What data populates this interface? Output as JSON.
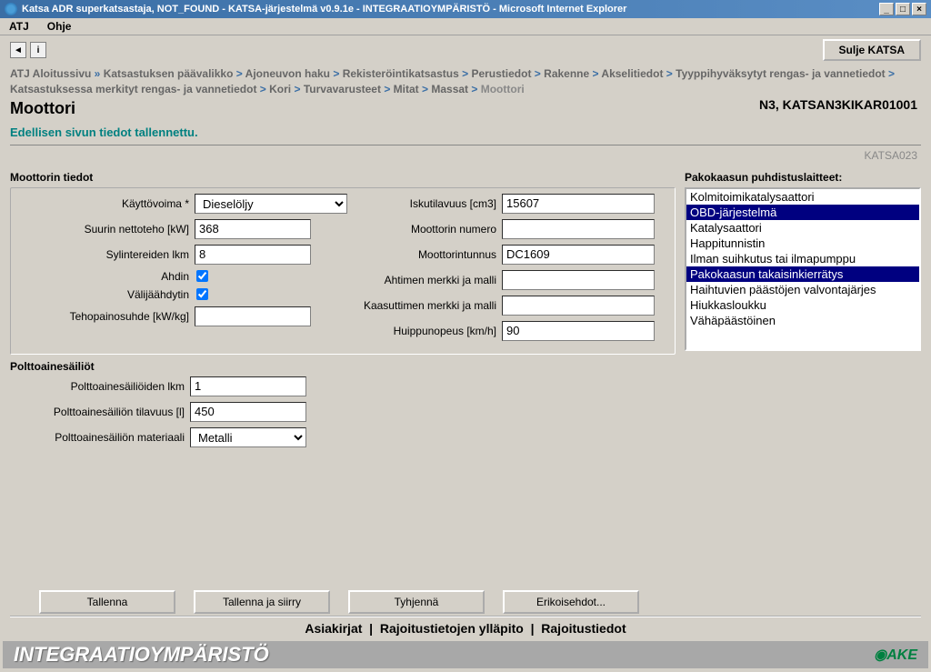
{
  "window": {
    "title": "Katsa ADR superkatsastaja, NOT_FOUND - KATSA-järjestelmä v0.9.1e - INTEGRAATIOYMPÄRISTÖ - Microsoft Internet Explorer"
  },
  "menubar": {
    "atj": "ATJ",
    "ohje": "Ohje"
  },
  "toolbar": {
    "close_katsa": "Sulje KATSA"
  },
  "breadcrumb": {
    "items": [
      "ATJ Aloitussivu",
      "Katsastuksen päävalikko",
      "Ajoneuvon haku",
      "Rekisteröintikatsastus",
      "Perustiedot",
      "Rakenne",
      "Akselitiedot",
      "Tyyppihyväksytyt rengas- ja vannetiedot",
      "Katsastuksessa merkityt rengas- ja vannetiedot",
      "Kori",
      "Turvavarusteet",
      "Mitat",
      "Massat",
      "Moottori"
    ]
  },
  "page": {
    "title": "Moottori",
    "vehicle_id": "N3, KATSAN3KIKAR01001",
    "status": "Edellisen sivun tiedot tallennettu.",
    "form_code": "KATSA023"
  },
  "sections": {
    "engine": "Moottorin tiedot",
    "fueltanks": "Polttoainesäiliöt",
    "exhaust": "Pakokaasun puhdistuslaitteet:"
  },
  "labels": {
    "fuel": "Käyttövoima *",
    "power": "Suurin nettoteho [kW]",
    "cylinders": "Sylintereiden lkm",
    "turbo": "Ahdin",
    "intercooler": "Välijäähdytin",
    "powerweight": "Tehopainosuhde [kW/kg]",
    "displacement": "Iskutilavuus [cm3]",
    "engineno": "Moottorin numero",
    "enginecode": "Moottorintunnus",
    "turbomodel": "Ahtimen merkki ja malli",
    "carbmodel": "Kaasuttimen merkki ja malli",
    "topspeed": "Huippunopeus [km/h]",
    "tankcount": "Polttoainesäiliöiden lkm",
    "tankvol": "Polttoainesäiliön tilavuus [l]",
    "tankmat": "Polttoainesäiliön materiaali"
  },
  "values": {
    "fuel": "Dieselöljy",
    "power": "368",
    "cylinders": "8",
    "turbo": true,
    "intercooler": true,
    "powerweight": "",
    "displacement": "15607",
    "engineno": "",
    "enginecode": "DC1609",
    "turbomodel": "",
    "carbmodel": "",
    "topspeed": "90",
    "tankcount": "1",
    "tankvol": "450",
    "tankmat": "Metalli"
  },
  "exhaust_items": [
    {
      "label": "Kolmitoimikatalysaattori",
      "selected": false
    },
    {
      "label": "OBD-järjestelmä",
      "selected": true
    },
    {
      "label": "Katalysaattori",
      "selected": false
    },
    {
      "label": "Happitunnistin",
      "selected": false
    },
    {
      "label": "Ilman suihkutus tai ilmapumppu",
      "selected": false
    },
    {
      "label": "Pakokaasun takaisinkierrätys",
      "selected": true
    },
    {
      "label": "Haihtuvien päästöjen valvontajärjes",
      "selected": false
    },
    {
      "label": "Hiukkasloukku",
      "selected": false
    },
    {
      "label": "Vähäpäästöinen",
      "selected": false
    }
  ],
  "buttons": {
    "save": "Tallenna",
    "save_next": "Tallenna ja siirry",
    "clear": "Tyhjennä",
    "special": "Erikoisehdot..."
  },
  "links": {
    "docs": "Asiakirjat",
    "restr_edit": "Rajoitustietojen ylläpito",
    "restr": "Rajoitustiedot"
  },
  "footer": {
    "env": "INTEGRAATIOYMPÄRISTÖ",
    "logo": "AKE"
  }
}
